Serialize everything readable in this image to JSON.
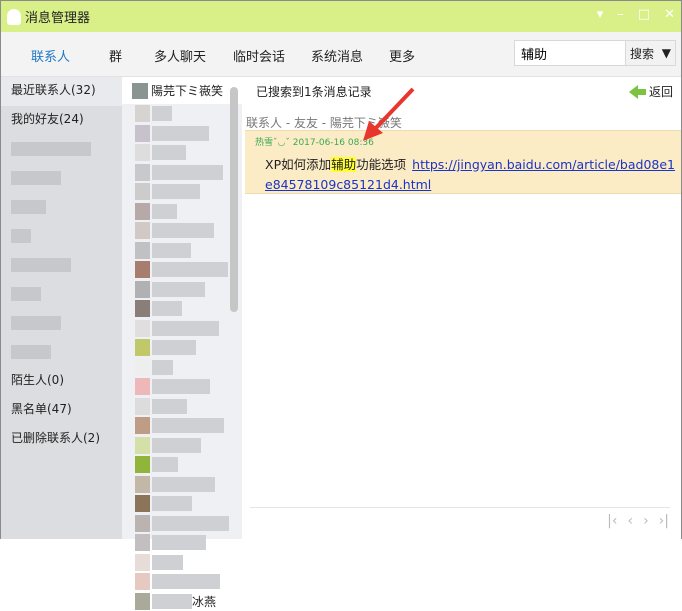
{
  "window": {
    "title": "消息管理器",
    "controls": [
      "▾",
      "–",
      "□",
      "✕"
    ]
  },
  "tabs": [
    "联系人",
    "群",
    "多人聊天",
    "临时会话",
    "系统消息",
    "更多"
  ],
  "search": {
    "value": "辅助",
    "button": "搜索"
  },
  "groups": [
    "最近联系人(32)",
    "我的好友(24)",
    "陌生人(0)",
    "黑名单(47)",
    "已删除联系人(2)"
  ],
  "contacts": {
    "selected": "陽芫下ミ嶶笑",
    "last": "冰燕"
  },
  "result": {
    "found": "已搜索到1条消息记录",
    "back": "返回",
    "path": "联系人 - 友友 - 陽芫下ミ嶶笑",
    "sender": "热雪ˇ◡ˇ",
    "time": "2017-06-16 08:",
    "time_tail": "36",
    "text_before": "XP如何添加",
    "highlight": "辅助",
    "text_after": "功能选项",
    "link": "https://jingyan.baidu.com/article/bad08e1e84578109c85121d4.html"
  },
  "pager": [
    "|‹",
    "‹",
    "›",
    "›|"
  ]
}
